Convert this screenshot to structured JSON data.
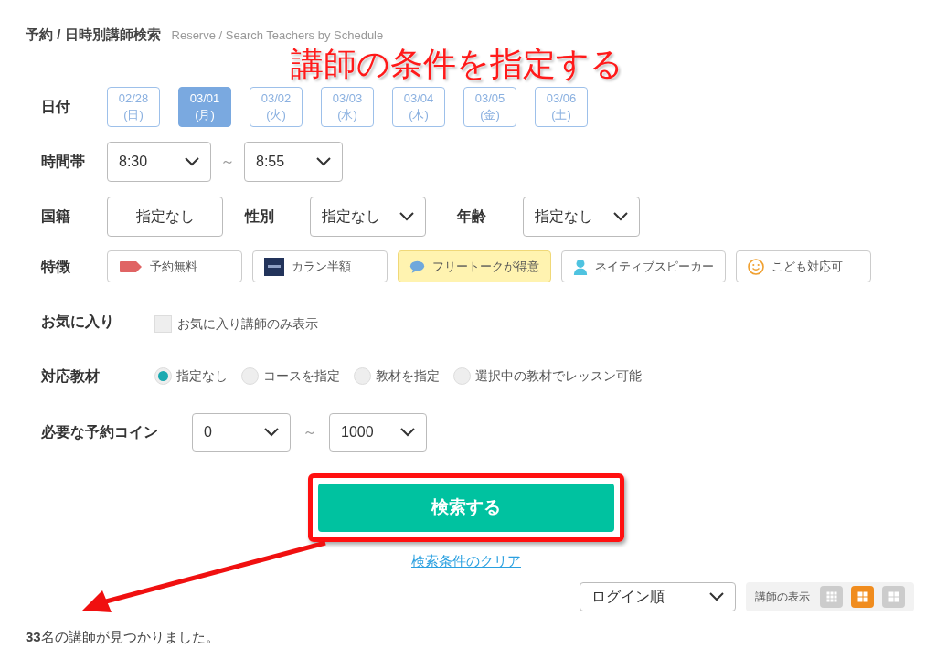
{
  "header": {
    "title": "予約 / 日時別講師検索",
    "subtitle": "Reserve / Search Teachers by Schedule"
  },
  "annotation": {
    "text": "講師の条件を指定する"
  },
  "date": {
    "label": "日付",
    "options": [
      {
        "date": "02/28",
        "day": "(日)",
        "selected": false
      },
      {
        "date": "03/01",
        "day": "(月)",
        "selected": true
      },
      {
        "date": "03/02",
        "day": "(火)",
        "selected": false
      },
      {
        "date": "03/03",
        "day": "(水)",
        "selected": false
      },
      {
        "date": "03/04",
        "day": "(木)",
        "selected": false
      },
      {
        "date": "03/05",
        "day": "(金)",
        "selected": false
      },
      {
        "date": "03/06",
        "day": "(土)",
        "selected": false
      }
    ]
  },
  "time": {
    "label": "時間帯",
    "from": "8:30",
    "separator": "～",
    "to": "8:55"
  },
  "nationality": {
    "label": "国籍",
    "value": "指定なし"
  },
  "gender": {
    "label": "性別",
    "value": "指定なし"
  },
  "age": {
    "label": "年齢",
    "value": "指定なし"
  },
  "features": {
    "label": "特徴",
    "items": [
      {
        "kind": "tag",
        "label": "予約無料",
        "selected": false
      },
      {
        "kind": "banner",
        "label": "カラン半額",
        "selected": false
      },
      {
        "kind": "bubble",
        "label": "フリートークが得意",
        "selected": true
      },
      {
        "kind": "person",
        "label": "ネイティブスピーカー",
        "selected": false
      },
      {
        "kind": "smile",
        "label": "こども対応可",
        "selected": false
      }
    ]
  },
  "favorites": {
    "label": "お気に入り",
    "option": "お気に入り講師のみ表示",
    "checked": false
  },
  "materials": {
    "label": "対応教材",
    "options": [
      {
        "label": "指定なし",
        "selected": true
      },
      {
        "label": "コースを指定",
        "selected": false
      },
      {
        "label": "教材を指定",
        "selected": false
      },
      {
        "label": "選択中の教材でレッスン可能",
        "selected": false
      }
    ]
  },
  "coins": {
    "label": "必要な予約コイン",
    "from": "0",
    "separator": "～",
    "to": "1000"
  },
  "search_button": "検索する",
  "clear_link": "検索条件のクリア",
  "sort": {
    "value": "ログイン順"
  },
  "view": {
    "label": "講師の表示",
    "options": [
      {
        "kind": "grid9",
        "selected": false
      },
      {
        "kind": "grid4",
        "selected": true
      },
      {
        "kind": "grid4",
        "selected": false
      }
    ]
  },
  "result": "**33**名の講師が見つかりました。"
}
